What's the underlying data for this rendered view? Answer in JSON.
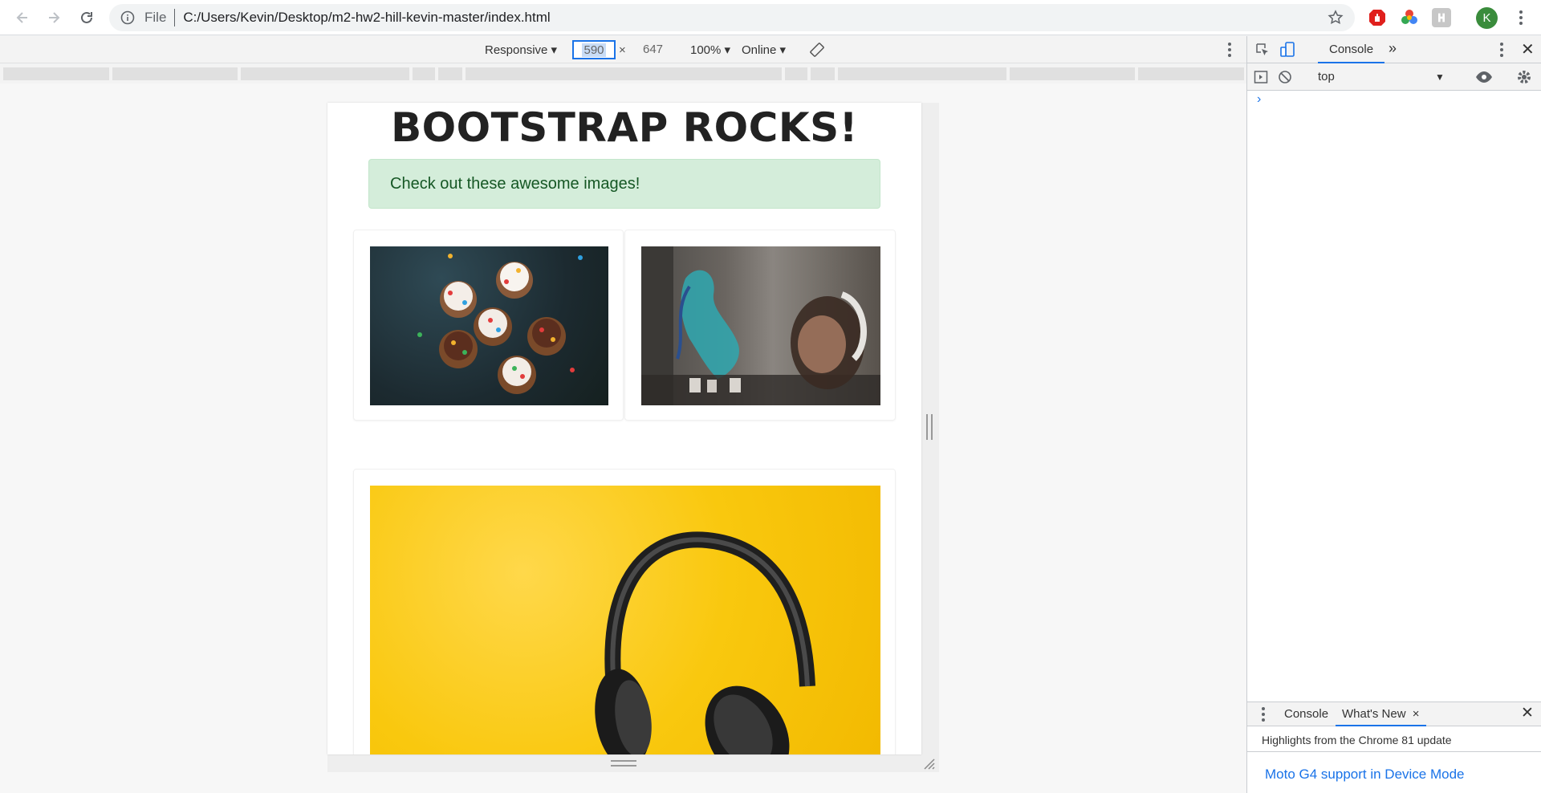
{
  "browser": {
    "file_label": "File",
    "url": "C:/Users/Kevin/Desktop/m2-hw2-hill-kevin-master/index.html",
    "avatar_initial": "K"
  },
  "device_toolbar": {
    "mode": "Responsive",
    "width": "590",
    "height": "647",
    "zoom": "100%",
    "network": "Online"
  },
  "page": {
    "title": "BOOTSTRAP ROCKS!",
    "alert": "Check out these awesome images!",
    "alert_color": "#d4edda"
  },
  "devtools": {
    "tab_console": "Console",
    "context": "top",
    "prompt": "›",
    "drawer_tab_console": "Console",
    "drawer_tab_whats_new": "What's New",
    "drawer_close": "×",
    "highlights": "Highlights from the Chrome 81 update",
    "link": "Moto G4 support in Device Mode"
  }
}
